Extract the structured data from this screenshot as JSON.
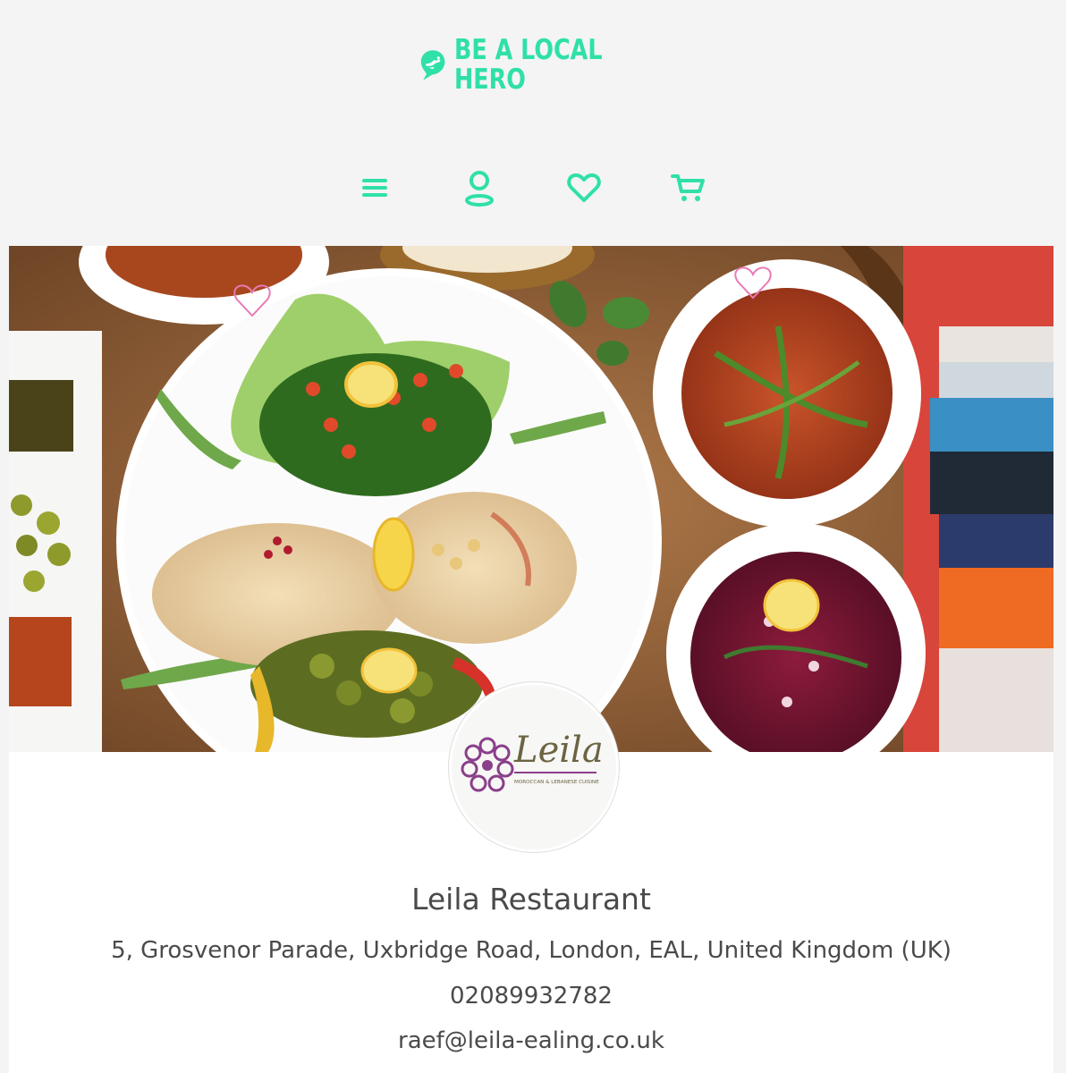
{
  "brand": {
    "line1": "BE A LOCAL",
    "line2": "HERO",
    "color": "#2fe0a8"
  },
  "nav": {
    "icons": [
      "menu-icon",
      "user-icon",
      "heart-icon",
      "cart-icon"
    ]
  },
  "hero": {
    "description_icon": "food-platter-photo"
  },
  "restaurant": {
    "logo_name": "Leila",
    "logo_tagline": "MOROCCAN & LEBANESE CUISINE",
    "name": "Leila Restaurant",
    "address": "5, Grosvenor Parade, Uxbridge Road, London, EAL, United Kingdom (UK)",
    "phone": "02089932782",
    "email": "raef@leila-ealing.co.uk"
  }
}
